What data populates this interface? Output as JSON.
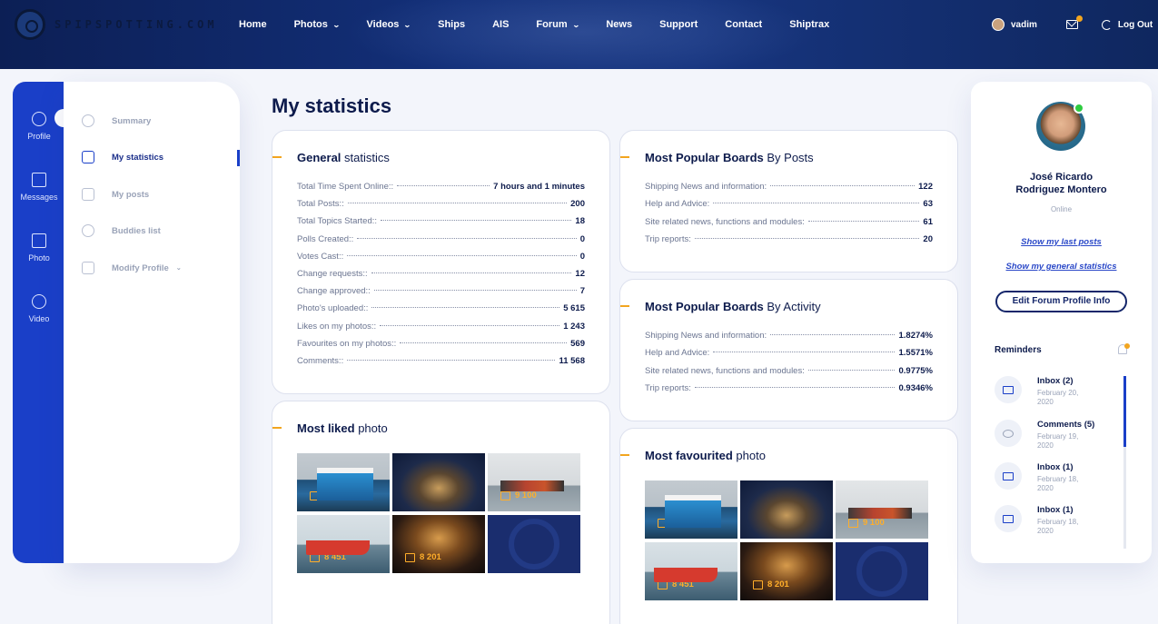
{
  "site": {
    "logo_text": "SPIPSPOTTING.COM"
  },
  "nav": [
    {
      "label": "Home",
      "dropdown": false
    },
    {
      "label": "Photos",
      "dropdown": true
    },
    {
      "label": "Videos",
      "dropdown": true
    },
    {
      "label": "Ships",
      "dropdown": false
    },
    {
      "label": "AIS",
      "dropdown": false
    },
    {
      "label": "Forum",
      "dropdown": true
    },
    {
      "label": "News",
      "dropdown": false
    },
    {
      "label": "Support",
      "dropdown": false
    },
    {
      "label": "Contact",
      "dropdown": false
    },
    {
      "label": "Shiptrax",
      "dropdown": false
    }
  ],
  "user": {
    "name": "vadim",
    "logout": "Log Out"
  },
  "rail": [
    {
      "label": "Profile",
      "icon": "profile-icon"
    },
    {
      "label": "Messages",
      "icon": "messages-icon"
    },
    {
      "label": "Photo",
      "icon": "photo-icon"
    },
    {
      "label": "Video",
      "icon": "video-icon"
    }
  ],
  "submenu": [
    {
      "label": "Summary",
      "active": false
    },
    {
      "label": "My statistics",
      "active": true
    },
    {
      "label": "My posts",
      "active": false
    },
    {
      "label": "Buddies list",
      "active": false
    },
    {
      "label": "Modify Profile",
      "active": false
    }
  ],
  "page": {
    "title": "My statistics"
  },
  "general": {
    "title_bold": "General",
    "title_rest": " statistics",
    "rows": [
      {
        "label": "Total Time Spent Online::",
        "value": "7 hours and 1 minutes"
      },
      {
        "label": "Total Posts::",
        "value": "200"
      },
      {
        "label": "Total Topics Started::",
        "value": "18"
      },
      {
        "label": "Polls Created::",
        "value": "0"
      },
      {
        "label": "Votes Cast::",
        "value": "0"
      },
      {
        "label": "Change requests::",
        "value": "12"
      },
      {
        "label": "Change approved::",
        "value": "7"
      },
      {
        "label": "Photo's uploaded::",
        "value": "5 615"
      },
      {
        "label": "Likes on my photos::",
        "value": "1 243"
      },
      {
        "label": "Favourites on my photos::",
        "value": "569"
      },
      {
        "label": "Comments::",
        "value": "11 568"
      }
    ]
  },
  "boards_posts": {
    "title_bold": "Most Popular Boards",
    "title_rest": " By Posts",
    "rows": [
      {
        "label": "Shipping News and information:",
        "value": "122"
      },
      {
        "label": "Help and Advice:",
        "value": "63"
      },
      {
        "label": "Site related news, functions and modules:",
        "value": "61"
      },
      {
        "label": "Trip reports:",
        "value": "20"
      }
    ]
  },
  "boards_activity": {
    "title_bold": "Most Popular Boards",
    "title_rest": " By Activity",
    "rows": [
      {
        "label": "Shipping News and information:",
        "value": "1.8274%"
      },
      {
        "label": "Help and Advice:",
        "value": "1.5571%"
      },
      {
        "label": "Site related news, functions and modules:",
        "value": "0.9775%"
      },
      {
        "label": "Trip reports:",
        "value": "0.9346%"
      }
    ]
  },
  "liked": {
    "title_bold": "Most liked",
    "title_rest": " photo",
    "photos": [
      "10 234",
      "",
      "9 100",
      "8 451",
      "8 201",
      ""
    ]
  },
  "favourited": {
    "title_bold": "Most favourited",
    "title_rest": " photo",
    "photos": [
      "10 234",
      "",
      "9 100",
      "8 451",
      "8 201",
      ""
    ]
  },
  "profile": {
    "name_line1": "José Ricardo",
    "name_line2": "Rodriguez Montero",
    "status": "Online",
    "link1": "Show my last posts",
    "link2": "Show my general statistics",
    "edit_button": "Edit Forum Profile Info",
    "reminders_title": "Reminders",
    "reminders": [
      {
        "title": "Inbox (2)",
        "date": "February 20, 2020",
        "icon": "chat-icon"
      },
      {
        "title": "Comments (5)",
        "date": "February 19, 2020",
        "icon": "comment-icon"
      },
      {
        "title": "Inbox (1)",
        "date": "February 18, 2020",
        "icon": "chat-icon"
      },
      {
        "title": "Inbox (1)",
        "date": "February 18, 2020",
        "icon": "chat-icon"
      }
    ]
  },
  "colors": {
    "accent": "#1a3fc8",
    "navy": "#0d1b4c",
    "orange": "#f2a51f",
    "online": "#2ecc40"
  }
}
